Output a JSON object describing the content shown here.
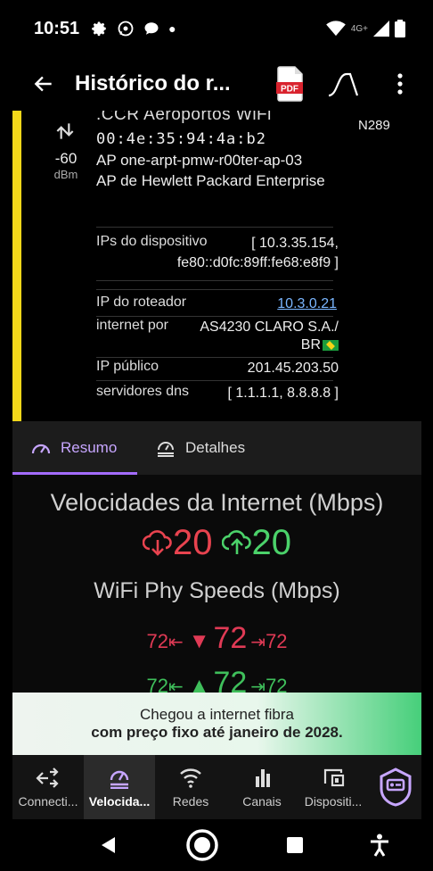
{
  "status_bar": {
    "time": "10:51",
    "network_label": "4G+"
  },
  "app_bar": {
    "title": "Histórico do r...",
    "pdf_label": "PDF"
  },
  "network": {
    "ssid": ".CCR Aeroportos WiFi",
    "mac": "00:4e:35:94:4a:b2",
    "ap_name": "AP one-arpt-pmw-r00ter-ap-03",
    "vendor": "AP de Hewlett Packard Enterprise",
    "signal_value": "-60",
    "signal_unit": "dBm",
    "channel": "N289",
    "device_ips_label": "IPs do dispositivo",
    "device_ips_line1": "[ 10.3.35.154,",
    "device_ips_line2": "fe80::d0fc:89ff:fe68:e8f9 ]",
    "router_ip_label": "IP do roteador",
    "router_ip": "10.3.0.21",
    "internet_by_label": "internet por",
    "internet_by_line1": "AS4230 CLARO S.A./",
    "internet_by_line2": "BR",
    "public_ip_label": "IP público",
    "public_ip": "201.45.203.50",
    "dns_label": "servidores dns",
    "dns": "[ 1.1.1.1, 8.8.8.8 ]"
  },
  "tabs": [
    {
      "label": "Resumo",
      "active": true
    },
    {
      "label": "Detalhes",
      "active": false
    }
  ],
  "speeds": {
    "title": "Velocidades da Internet (Mbps)",
    "download": "20",
    "upload": "20",
    "phy_title": "WiFi Phy Speeds (Mbps)",
    "phy_rx_small_left": "72",
    "phy_rx_big": "72",
    "phy_rx_small_right": "72",
    "phy_tx_small_left": "72",
    "phy_tx_big": "72",
    "phy_tx_small_right": "72"
  },
  "banner": {
    "line1": "Chegou a internet fibra",
    "line2": "com preço fixo até janeiro de 2028."
  },
  "bottom_nav": [
    {
      "label": "Connecti...",
      "icon": "connection-icon",
      "active": false
    },
    {
      "label": "Velocida...",
      "icon": "speedometer-icon",
      "active": true
    },
    {
      "label": "Redes",
      "icon": "wifi-icon",
      "active": false
    },
    {
      "label": "Canais",
      "icon": "bar-chart-icon",
      "active": false
    },
    {
      "label": "Dispositi...",
      "icon": "devices-icon",
      "active": false
    }
  ],
  "colors": {
    "accent": "#a46cff",
    "download": "#e8434f",
    "upload": "#4bd26a",
    "signal_bar": "#f4d81a"
  }
}
